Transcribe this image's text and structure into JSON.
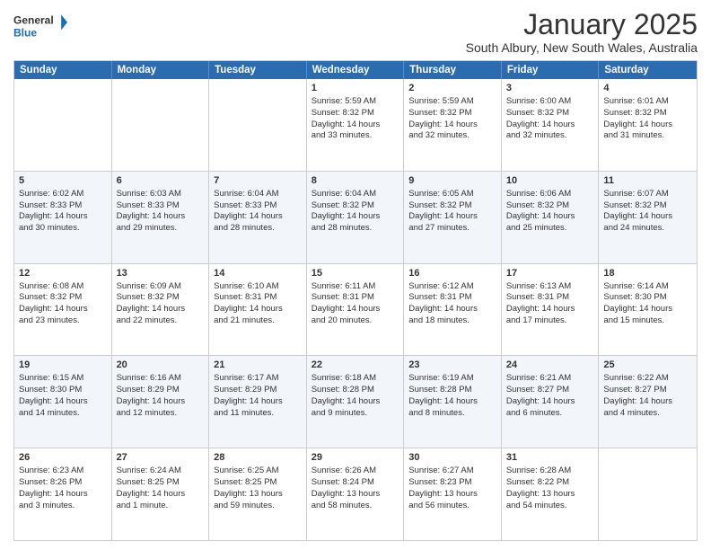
{
  "logo": {
    "text1": "General",
    "text2": "Blue"
  },
  "title": "January 2025",
  "subtitle": "South Albury, New South Wales, Australia",
  "header_days": [
    "Sunday",
    "Monday",
    "Tuesday",
    "Wednesday",
    "Thursday",
    "Friday",
    "Saturday"
  ],
  "weeks": [
    {
      "alt": false,
      "days": [
        {
          "num": "",
          "lines": []
        },
        {
          "num": "",
          "lines": []
        },
        {
          "num": "",
          "lines": []
        },
        {
          "num": "1",
          "lines": [
            "Sunrise: 5:59 AM",
            "Sunset: 8:32 PM",
            "Daylight: 14 hours",
            "and 33 minutes."
          ]
        },
        {
          "num": "2",
          "lines": [
            "Sunrise: 5:59 AM",
            "Sunset: 8:32 PM",
            "Daylight: 14 hours",
            "and 32 minutes."
          ]
        },
        {
          "num": "3",
          "lines": [
            "Sunrise: 6:00 AM",
            "Sunset: 8:32 PM",
            "Daylight: 14 hours",
            "and 32 minutes."
          ]
        },
        {
          "num": "4",
          "lines": [
            "Sunrise: 6:01 AM",
            "Sunset: 8:32 PM",
            "Daylight: 14 hours",
            "and 31 minutes."
          ]
        }
      ]
    },
    {
      "alt": true,
      "days": [
        {
          "num": "5",
          "lines": [
            "Sunrise: 6:02 AM",
            "Sunset: 8:33 PM",
            "Daylight: 14 hours",
            "and 30 minutes."
          ]
        },
        {
          "num": "6",
          "lines": [
            "Sunrise: 6:03 AM",
            "Sunset: 8:33 PM",
            "Daylight: 14 hours",
            "and 29 minutes."
          ]
        },
        {
          "num": "7",
          "lines": [
            "Sunrise: 6:04 AM",
            "Sunset: 8:33 PM",
            "Daylight: 14 hours",
            "and 28 minutes."
          ]
        },
        {
          "num": "8",
          "lines": [
            "Sunrise: 6:04 AM",
            "Sunset: 8:32 PM",
            "Daylight: 14 hours",
            "and 28 minutes."
          ]
        },
        {
          "num": "9",
          "lines": [
            "Sunrise: 6:05 AM",
            "Sunset: 8:32 PM",
            "Daylight: 14 hours",
            "and 27 minutes."
          ]
        },
        {
          "num": "10",
          "lines": [
            "Sunrise: 6:06 AM",
            "Sunset: 8:32 PM",
            "Daylight: 14 hours",
            "and 25 minutes."
          ]
        },
        {
          "num": "11",
          "lines": [
            "Sunrise: 6:07 AM",
            "Sunset: 8:32 PM",
            "Daylight: 14 hours",
            "and 24 minutes."
          ]
        }
      ]
    },
    {
      "alt": false,
      "days": [
        {
          "num": "12",
          "lines": [
            "Sunrise: 6:08 AM",
            "Sunset: 8:32 PM",
            "Daylight: 14 hours",
            "and 23 minutes."
          ]
        },
        {
          "num": "13",
          "lines": [
            "Sunrise: 6:09 AM",
            "Sunset: 8:32 PM",
            "Daylight: 14 hours",
            "and 22 minutes."
          ]
        },
        {
          "num": "14",
          "lines": [
            "Sunrise: 6:10 AM",
            "Sunset: 8:31 PM",
            "Daylight: 14 hours",
            "and 21 minutes."
          ]
        },
        {
          "num": "15",
          "lines": [
            "Sunrise: 6:11 AM",
            "Sunset: 8:31 PM",
            "Daylight: 14 hours",
            "and 20 minutes."
          ]
        },
        {
          "num": "16",
          "lines": [
            "Sunrise: 6:12 AM",
            "Sunset: 8:31 PM",
            "Daylight: 14 hours",
            "and 18 minutes."
          ]
        },
        {
          "num": "17",
          "lines": [
            "Sunrise: 6:13 AM",
            "Sunset: 8:31 PM",
            "Daylight: 14 hours",
            "and 17 minutes."
          ]
        },
        {
          "num": "18",
          "lines": [
            "Sunrise: 6:14 AM",
            "Sunset: 8:30 PM",
            "Daylight: 14 hours",
            "and 15 minutes."
          ]
        }
      ]
    },
    {
      "alt": true,
      "days": [
        {
          "num": "19",
          "lines": [
            "Sunrise: 6:15 AM",
            "Sunset: 8:30 PM",
            "Daylight: 14 hours",
            "and 14 minutes."
          ]
        },
        {
          "num": "20",
          "lines": [
            "Sunrise: 6:16 AM",
            "Sunset: 8:29 PM",
            "Daylight: 14 hours",
            "and 12 minutes."
          ]
        },
        {
          "num": "21",
          "lines": [
            "Sunrise: 6:17 AM",
            "Sunset: 8:29 PM",
            "Daylight: 14 hours",
            "and 11 minutes."
          ]
        },
        {
          "num": "22",
          "lines": [
            "Sunrise: 6:18 AM",
            "Sunset: 8:28 PM",
            "Daylight: 14 hours",
            "and 9 minutes."
          ]
        },
        {
          "num": "23",
          "lines": [
            "Sunrise: 6:19 AM",
            "Sunset: 8:28 PM",
            "Daylight: 14 hours",
            "and 8 minutes."
          ]
        },
        {
          "num": "24",
          "lines": [
            "Sunrise: 6:21 AM",
            "Sunset: 8:27 PM",
            "Daylight: 14 hours",
            "and 6 minutes."
          ]
        },
        {
          "num": "25",
          "lines": [
            "Sunrise: 6:22 AM",
            "Sunset: 8:27 PM",
            "Daylight: 14 hours",
            "and 4 minutes."
          ]
        }
      ]
    },
    {
      "alt": false,
      "days": [
        {
          "num": "26",
          "lines": [
            "Sunrise: 6:23 AM",
            "Sunset: 8:26 PM",
            "Daylight: 14 hours",
            "and 3 minutes."
          ]
        },
        {
          "num": "27",
          "lines": [
            "Sunrise: 6:24 AM",
            "Sunset: 8:25 PM",
            "Daylight: 14 hours",
            "and 1 minute."
          ]
        },
        {
          "num": "28",
          "lines": [
            "Sunrise: 6:25 AM",
            "Sunset: 8:25 PM",
            "Daylight: 13 hours",
            "and 59 minutes."
          ]
        },
        {
          "num": "29",
          "lines": [
            "Sunrise: 6:26 AM",
            "Sunset: 8:24 PM",
            "Daylight: 13 hours",
            "and 58 minutes."
          ]
        },
        {
          "num": "30",
          "lines": [
            "Sunrise: 6:27 AM",
            "Sunset: 8:23 PM",
            "Daylight: 13 hours",
            "and 56 minutes."
          ]
        },
        {
          "num": "31",
          "lines": [
            "Sunrise: 6:28 AM",
            "Sunset: 8:22 PM",
            "Daylight: 13 hours",
            "and 54 minutes."
          ]
        },
        {
          "num": "",
          "lines": []
        }
      ]
    }
  ]
}
